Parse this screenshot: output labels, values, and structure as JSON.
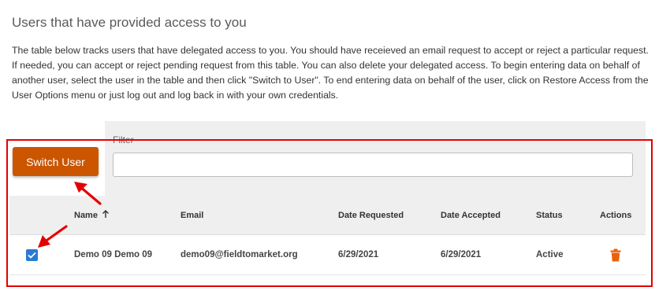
{
  "section": {
    "title": "Users that have provided access to you",
    "description": "The table below tracks users that have delegated access to you. You should have receieved an email request to accept or reject a particular request. If needed, you can accept or reject pending request from this table. You can also delete your delegated access. To begin entering data on behalf of another user, select the user in the table and then click \"Switch to User\". To end entering data on behalf of the user, click on Restore Access from the User Options menu or just log out and log back in with your own credentials."
  },
  "toolbar": {
    "switch_user_label": "Switch User",
    "filter_label": "Filter",
    "filter_value": "",
    "filter_placeholder": ""
  },
  "table": {
    "columns": {
      "name": "Name",
      "email": "Email",
      "date_requested": "Date Requested",
      "date_accepted": "Date Accepted",
      "status": "Status",
      "actions": "Actions"
    },
    "sort": {
      "column": "name",
      "direction": "ascending",
      "icon": "arrow-up-icon"
    },
    "rows": [
      {
        "selected": true,
        "name": "Demo 09 Demo 09",
        "email": "demo09@fieldtomarket.org",
        "date_requested": "6/29/2021",
        "date_accepted": "6/29/2021",
        "status": "Active",
        "action_icon": "trash-icon"
      }
    ]
  },
  "colors": {
    "accent": "#cc5500",
    "checkbox": "#2a7ad1",
    "annotation": "#e50000",
    "panel_background": "#efefef"
  },
  "annotations": {
    "highlight": "red-rectangle",
    "arrows": [
      "arrow-to-switch-user",
      "arrow-to-checkbox"
    ]
  }
}
